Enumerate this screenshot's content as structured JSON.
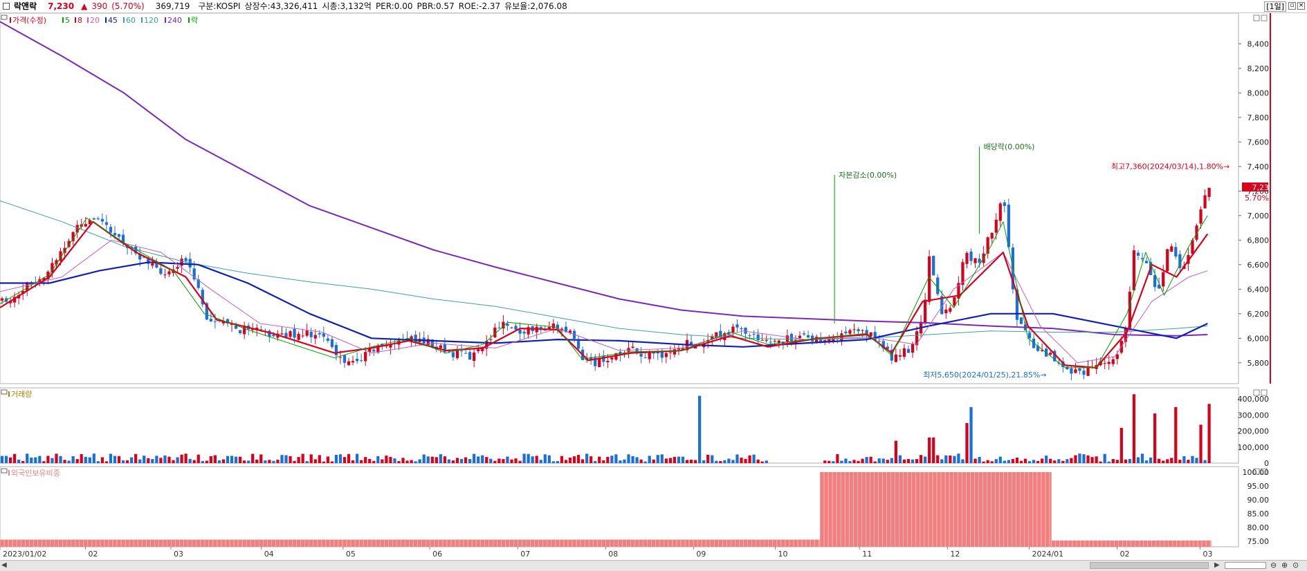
{
  "header": {
    "name": "락앤락",
    "price": "7,230",
    "arrow": "▲",
    "change": "390",
    "change_pct": "(5.70%)",
    "volume": "369,719",
    "market": "구분:KOSPI",
    "listed": "상장수:43,326,411",
    "cap": "시총:3,132억",
    "per": "PER:0.00",
    "pbr": "PBR:0.57",
    "roe": "ROE:-2.37",
    "float": "유보율:2,076.08",
    "period": "[1일]"
  },
  "legend": {
    "price_label": "가격(수정)",
    "ma": [
      {
        "label": "5",
        "color": "#00a000"
      },
      {
        "label": "8",
        "color": "#d9001b"
      },
      {
        "label": "20",
        "color": "#c060c0"
      },
      {
        "label": "45",
        "color": "#1020b0"
      },
      {
        "label": "60",
        "color": "#3aa0a0"
      },
      {
        "label": "120",
        "color": "#40a0a0"
      },
      {
        "label": "240",
        "color": "#7a28b8"
      }
    ],
    "event_label": "락",
    "volume_label": "거래량",
    "foreign_label": "외국인보유비중"
  },
  "colors": {
    "up": "#d9001b",
    "down": "#1a6fd8",
    "ma5": "#00a000",
    "ma8": "#d9001b",
    "ma20": "#c060c0",
    "ma45": "#1020b0",
    "ma120": "#40a0a0",
    "ma240": "#7a28b8",
    "foreign_bar": "#f08080"
  },
  "chart_data": [
    {
      "type": "candlestick",
      "title": "가격(수정)",
      "y_ticks": [
        5800,
        6000,
        6200,
        6400,
        6600,
        6800,
        7000,
        7200,
        7400,
        7600,
        7800,
        8000,
        8200,
        8400
      ],
      "y_tick_labels": [
        "5,800",
        "6,000",
        "6,200",
        "6,400",
        "6,600",
        "6,800",
        "7,000",
        "7,200",
        "7,400",
        "7,600",
        "7,800",
        "8,000",
        "8,200",
        "8,400"
      ],
      "ylim": [
        5630,
        8650
      ],
      "x_labels": [
        "2023/01/02",
        "02",
        "03",
        "04",
        "05",
        "06",
        "07",
        "08",
        "09",
        "10",
        "11",
        "12",
        "2024/01",
        "02",
        "03"
      ],
      "x_label_fracs": [
        0.0,
        0.069,
        0.138,
        0.211,
        0.277,
        0.347,
        0.418,
        0.489,
        0.56,
        0.626,
        0.694,
        0.765,
        0.831,
        0.902,
        0.969
      ],
      "price_path": [
        [
          0.0,
          6300
        ],
        [
          0.012,
          6350
        ],
        [
          0.025,
          6450
        ],
        [
          0.04,
          6560
        ],
        [
          0.055,
          6800
        ],
        [
          0.065,
          6950
        ],
        [
          0.075,
          6980
        ],
        [
          0.085,
          6900
        ],
        [
          0.1,
          6780
        ],
        [
          0.11,
          6700
        ],
        [
          0.12,
          6600
        ],
        [
          0.135,
          6500
        ],
        [
          0.15,
          6650
        ],
        [
          0.16,
          6450
        ],
        [
          0.165,
          6200
        ],
        [
          0.175,
          6120
        ],
        [
          0.19,
          6080
        ],
        [
          0.205,
          6060
        ],
        [
          0.225,
          6020
        ],
        [
          0.245,
          6050
        ],
        [
          0.262,
          6000
        ],
        [
          0.272,
          5850
        ],
        [
          0.285,
          5800
        ],
        [
          0.3,
          5900
        ],
        [
          0.315,
          5960
        ],
        [
          0.33,
          6000
        ],
        [
          0.35,
          5950
        ],
        [
          0.365,
          5880
        ],
        [
          0.38,
          5850
        ],
        [
          0.395,
          6000
        ],
        [
          0.405,
          6150
        ],
        [
          0.415,
          6050
        ],
        [
          0.43,
          6080
        ],
        [
          0.445,
          6100
        ],
        [
          0.46,
          6050
        ],
        [
          0.47,
          5850
        ],
        [
          0.48,
          5800
        ],
        [
          0.495,
          5850
        ],
        [
          0.51,
          5900
        ],
        [
          0.525,
          5850
        ],
        [
          0.54,
          5880
        ],
        [
          0.555,
          5960
        ],
        [
          0.57,
          5980
        ],
        [
          0.585,
          6050
        ],
        [
          0.6,
          6080
        ],
        [
          0.615,
          5950
        ],
        [
          0.625,
          5980
        ],
        [
          0.645,
          6000
        ],
        [
          0.66,
          6000
        ],
        [
          0.674,
          6000
        ],
        [
          0.69,
          6050
        ],
        [
          0.705,
          6030
        ],
        [
          0.72,
          5850
        ],
        [
          0.735,
          5900
        ],
        [
          0.745,
          6150
        ],
        [
          0.75,
          6650
        ],
        [
          0.76,
          6200
        ],
        [
          0.77,
          6300
        ],
        [
          0.78,
          6700
        ],
        [
          0.79,
          6600
        ],
        [
          0.8,
          6850
        ],
        [
          0.81,
          7150
        ],
        [
          0.82,
          6200
        ],
        [
          0.83,
          6000
        ],
        [
          0.84,
          5900
        ],
        [
          0.85,
          5850
        ],
        [
          0.86,
          5750
        ],
        [
          0.875,
          5720
        ],
        [
          0.885,
          5800
        ],
        [
          0.9,
          5850
        ],
        [
          0.91,
          6100
        ],
        [
          0.915,
          6700
        ],
        [
          0.925,
          6650
        ],
        [
          0.935,
          6350
        ],
        [
          0.945,
          6800
        ],
        [
          0.955,
          6550
        ],
        [
          0.965,
          6850
        ],
        [
          0.975,
          7230
        ]
      ],
      "ma_paths": {
        "ma240": [
          [
            0.0,
            8580
          ],
          [
            0.05,
            8300
          ],
          [
            0.1,
            8000
          ],
          [
            0.15,
            7620
          ],
          [
            0.2,
            7350
          ],
          [
            0.25,
            7080
          ],
          [
            0.3,
            6900
          ],
          [
            0.35,
            6720
          ],
          [
            0.4,
            6580
          ],
          [
            0.45,
            6450
          ],
          [
            0.5,
            6320
          ],
          [
            0.55,
            6230
          ],
          [
            0.6,
            6180
          ],
          [
            0.65,
            6160
          ],
          [
            0.7,
            6140
          ],
          [
            0.75,
            6125
          ],
          [
            0.8,
            6100
          ],
          [
            0.85,
            6080
          ],
          [
            0.9,
            6030
          ],
          [
            0.95,
            6020
          ],
          [
            0.975,
            6030
          ]
        ],
        "ma120": [
          [
            0.0,
            7120
          ],
          [
            0.05,
            6950
          ],
          [
            0.1,
            6750
          ],
          [
            0.15,
            6620
          ],
          [
            0.2,
            6530
          ],
          [
            0.25,
            6460
          ],
          [
            0.3,
            6400
          ],
          [
            0.35,
            6320
          ],
          [
            0.4,
            6260
          ],
          [
            0.45,
            6170
          ],
          [
            0.5,
            6080
          ],
          [
            0.55,
            6030
          ],
          [
            0.6,
            6000
          ],
          [
            0.65,
            5990
          ],
          [
            0.7,
            6000
          ],
          [
            0.75,
            6030
          ],
          [
            0.8,
            6060
          ],
          [
            0.85,
            6050
          ],
          [
            0.9,
            6050
          ],
          [
            0.95,
            6080
          ],
          [
            0.975,
            6100
          ]
        ],
        "ma45": [
          [
            0.0,
            6450
          ],
          [
            0.04,
            6450
          ],
          [
            0.08,
            6550
          ],
          [
            0.12,
            6620
          ],
          [
            0.16,
            6600
          ],
          [
            0.2,
            6450
          ],
          [
            0.25,
            6200
          ],
          [
            0.3,
            6000
          ],
          [
            0.35,
            5980
          ],
          [
            0.4,
            5960
          ],
          [
            0.45,
            5990
          ],
          [
            0.5,
            5980
          ],
          [
            0.55,
            5950
          ],
          [
            0.6,
            5930
          ],
          [
            0.65,
            5960
          ],
          [
            0.7,
            5990
          ],
          [
            0.75,
            6100
          ],
          [
            0.8,
            6200
          ],
          [
            0.85,
            6200
          ],
          [
            0.9,
            6100
          ],
          [
            0.95,
            6000
          ],
          [
            0.975,
            6120
          ]
        ],
        "ma20": [
          [
            0.0,
            6380
          ],
          [
            0.05,
            6500
          ],
          [
            0.09,
            6800
          ],
          [
            0.13,
            6700
          ],
          [
            0.17,
            6400
          ],
          [
            0.21,
            6120
          ],
          [
            0.26,
            6050
          ],
          [
            0.3,
            5880
          ],
          [
            0.35,
            5960
          ],
          [
            0.4,
            5920
          ],
          [
            0.45,
            6080
          ],
          [
            0.5,
            5900
          ],
          [
            0.55,
            5920
          ],
          [
            0.6,
            6060
          ],
          [
            0.65,
            5990
          ],
          [
            0.7,
            6010
          ],
          [
            0.74,
            5950
          ],
          [
            0.77,
            6400
          ],
          [
            0.81,
            6700
          ],
          [
            0.84,
            6100
          ],
          [
            0.87,
            5800
          ],
          [
            0.9,
            5850
          ],
          [
            0.93,
            6300
          ],
          [
            0.96,
            6500
          ],
          [
            0.975,
            6550
          ]
        ],
        "ma8": [
          [
            0.0,
            6250
          ],
          [
            0.04,
            6500
          ],
          [
            0.075,
            6950
          ],
          [
            0.11,
            6700
          ],
          [
            0.15,
            6500
          ],
          [
            0.175,
            6150
          ],
          [
            0.22,
            6040
          ],
          [
            0.27,
            5880
          ],
          [
            0.3,
            5920
          ],
          [
            0.33,
            5980
          ],
          [
            0.36,
            5900
          ],
          [
            0.39,
            5920
          ],
          [
            0.42,
            6080
          ],
          [
            0.45,
            6070
          ],
          [
            0.475,
            5820
          ],
          [
            0.51,
            5880
          ],
          [
            0.55,
            5900
          ],
          [
            0.59,
            6020
          ],
          [
            0.62,
            5930
          ],
          [
            0.66,
            6000
          ],
          [
            0.7,
            6030
          ],
          [
            0.72,
            5880
          ],
          [
            0.745,
            6300
          ],
          [
            0.775,
            6350
          ],
          [
            0.81,
            6700
          ],
          [
            0.83,
            6100
          ],
          [
            0.86,
            5780
          ],
          [
            0.885,
            5760
          ],
          [
            0.91,
            6050
          ],
          [
            0.93,
            6600
          ],
          [
            0.95,
            6500
          ],
          [
            0.975,
            6850
          ]
        ],
        "ma5": [
          [
            0.0,
            6280
          ],
          [
            0.04,
            6520
          ],
          [
            0.07,
            6980
          ],
          [
            0.1,
            6780
          ],
          [
            0.14,
            6550
          ],
          [
            0.165,
            6200
          ],
          [
            0.2,
            6070
          ],
          [
            0.27,
            5840
          ],
          [
            0.3,
            5930
          ],
          [
            0.33,
            6000
          ],
          [
            0.36,
            5880
          ],
          [
            0.39,
            5950
          ],
          [
            0.41,
            6130
          ],
          [
            0.45,
            6090
          ],
          [
            0.47,
            5830
          ],
          [
            0.51,
            5890
          ],
          [
            0.55,
            5900
          ],
          [
            0.59,
            6050
          ],
          [
            0.62,
            5950
          ],
          [
            0.66,
            6000
          ],
          [
            0.7,
            6040
          ],
          [
            0.72,
            5860
          ],
          [
            0.75,
            6500
          ],
          [
            0.77,
            6250
          ],
          [
            0.8,
            6750
          ],
          [
            0.81,
            6950
          ],
          [
            0.83,
            6000
          ],
          [
            0.86,
            5760
          ],
          [
            0.885,
            5760
          ],
          [
            0.91,
            6200
          ],
          [
            0.925,
            6700
          ],
          [
            0.94,
            6350
          ],
          [
            0.96,
            6750
          ],
          [
            0.975,
            7000
          ]
        ]
      },
      "annotations": [
        {
          "text": "자본감소(0.00%)",
          "x_frac": 0.666,
          "y": 7310,
          "line_to": 6120
        },
        {
          "text": "배당락(0.00%)",
          "x_frac": 0.783,
          "y": 7540,
          "line_to": 6850
        },
        {
          "text": "최고7,360(2024/03/14),1.80%→",
          "x_frac": 0.945,
          "y": 7380
        },
        {
          "text": "최저5,650(2024/01/25),21.85%→",
          "x_frac": 0.845,
          "y": 5680
        }
      ],
      "last_price_label": "7,230",
      "last_pct_label": "5.70%",
      "last_price": 7230
    },
    {
      "type": "bar",
      "title": "거래량",
      "y_ticks": [
        0,
        100000,
        200000,
        300000,
        400000
      ],
      "y_tick_labels": [
        "0",
        "100,000",
        "200,000",
        "300,000",
        "400,000"
      ],
      "ylim": [
        0,
        470000
      ],
      "spikes": [
        {
          "x_frac": 0.566,
          "value": 420000,
          "dir": "down"
        },
        {
          "x_frac": 0.784,
          "value": 350000,
          "dir": "down"
        },
        {
          "x_frac": 0.78,
          "value": 250000,
          "dir": "up"
        },
        {
          "x_frac": 0.752,
          "value": 160000,
          "dir": "up"
        },
        {
          "x_frac": 0.722,
          "value": 140000,
          "dir": "up"
        },
        {
          "x_frac": 0.905,
          "value": 220000,
          "dir": "up"
        },
        {
          "x_frac": 0.917,
          "value": 430000,
          "dir": "up"
        },
        {
          "x_frac": 0.931,
          "value": 310000,
          "dir": "up"
        },
        {
          "x_frac": 0.949,
          "value": 350000,
          "dir": "up"
        },
        {
          "x_frac": 0.969,
          "value": 240000,
          "dir": "up"
        },
        {
          "x_frac": 0.975,
          "value": 369719,
          "dir": "up"
        }
      ]
    },
    {
      "type": "bar",
      "title": "외국인보유비중",
      "y_ticks": [
        75,
        80,
        85,
        90,
        95,
        100
      ],
      "y_tick_labels": [
        "75.00",
        "80.00",
        "85.00",
        "90.00",
        "95.00",
        "100.00"
      ],
      "ylim": [
        73,
        102
      ],
      "segments": [
        {
          "from": 0.0,
          "to": 0.662,
          "value": 75.6
        },
        {
          "from": 0.662,
          "to": 0.849,
          "value": 100.0
        },
        {
          "from": 0.849,
          "to": 0.978,
          "value": 75.3
        }
      ]
    }
  ]
}
